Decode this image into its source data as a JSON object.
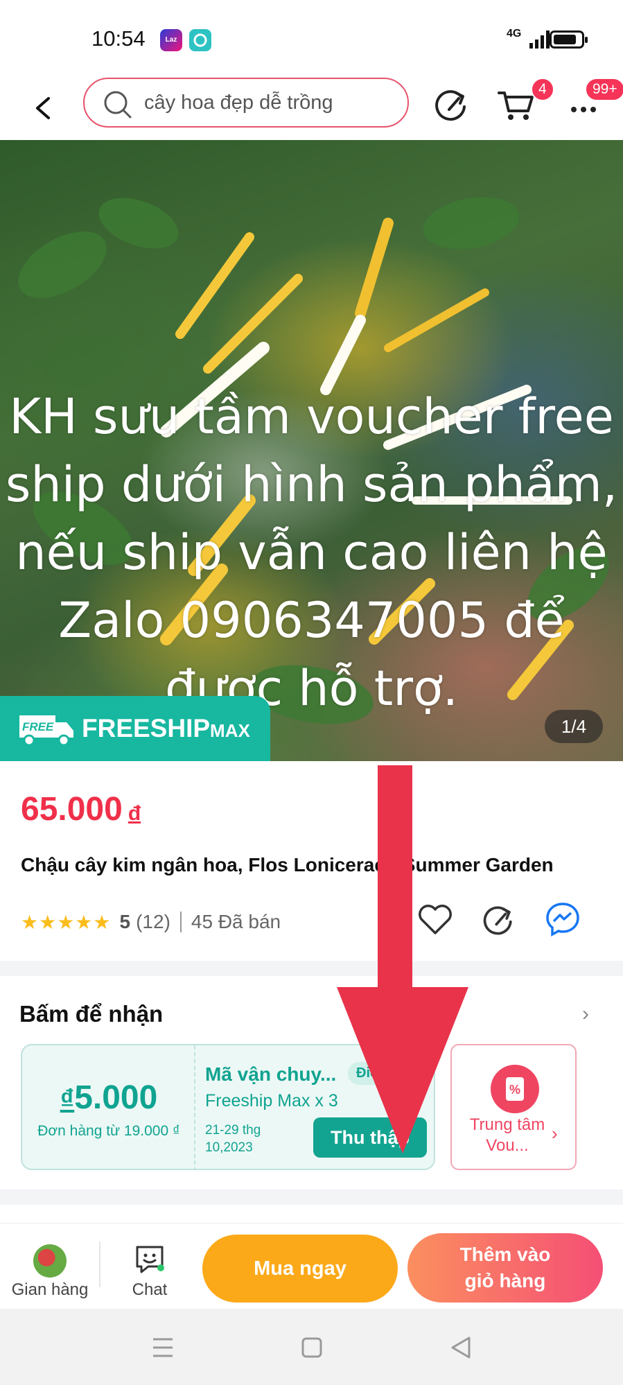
{
  "status_bar": {
    "time": "10:54",
    "network": "4G",
    "apps": [
      {
        "name": "lazada",
        "label": "Laz"
      },
      {
        "name": "zalo",
        "label": ""
      }
    ]
  },
  "header": {
    "search_query": "cây hoa đẹp dễ trồng",
    "cart_count": "4",
    "more_count": "99+"
  },
  "hero": {
    "overlay_text": "KH sưu tầm voucher free\nship dưới hình sản phẩm,\nnếu ship vẫn cao liên hệ\nZalo 0906347005 để\nđược hỗ trợ.",
    "freeship_label": "FREESHIP",
    "freeship_max": "MAX",
    "freeship_tag": "FREE",
    "image_counter": "1/4"
  },
  "product": {
    "price": "65.000",
    "currency": "đ",
    "title": "Chậu cây kim ngân hoa, Flos Lonicerae - Summer Garden",
    "stars": "★★★★★",
    "rating": "5",
    "review_count": "(12)",
    "sold": "45 Đã bán"
  },
  "voucher_section": {
    "title": "Bấm để nhận",
    "chevron": "›",
    "voucher": {
      "currency": "₫",
      "amount": "5.000",
      "min_order": "Đơn hàng từ 19.000 ₫",
      "name": "Mã vận chuy...",
      "condition_badge": "Điều",
      "subtitle": "Freeship Max x 3",
      "date": "21-29 thg 10,2023",
      "collect_label": "Thu thập"
    },
    "center": {
      "label": "Trung tâm Vou...",
      "chevron": "›"
    }
  },
  "bottom_bar": {
    "store_label": "Gian hàng",
    "chat_label": "Chat",
    "buy_now_label": "Mua ngay",
    "add_cart_line1": "Thêm vào",
    "add_cart_line2": "giỏ hàng"
  },
  "colors": {
    "brand_pink": "#f0304a",
    "teal": "#13a491",
    "orange": "#fba919",
    "arrow_red": "#e8334a"
  }
}
